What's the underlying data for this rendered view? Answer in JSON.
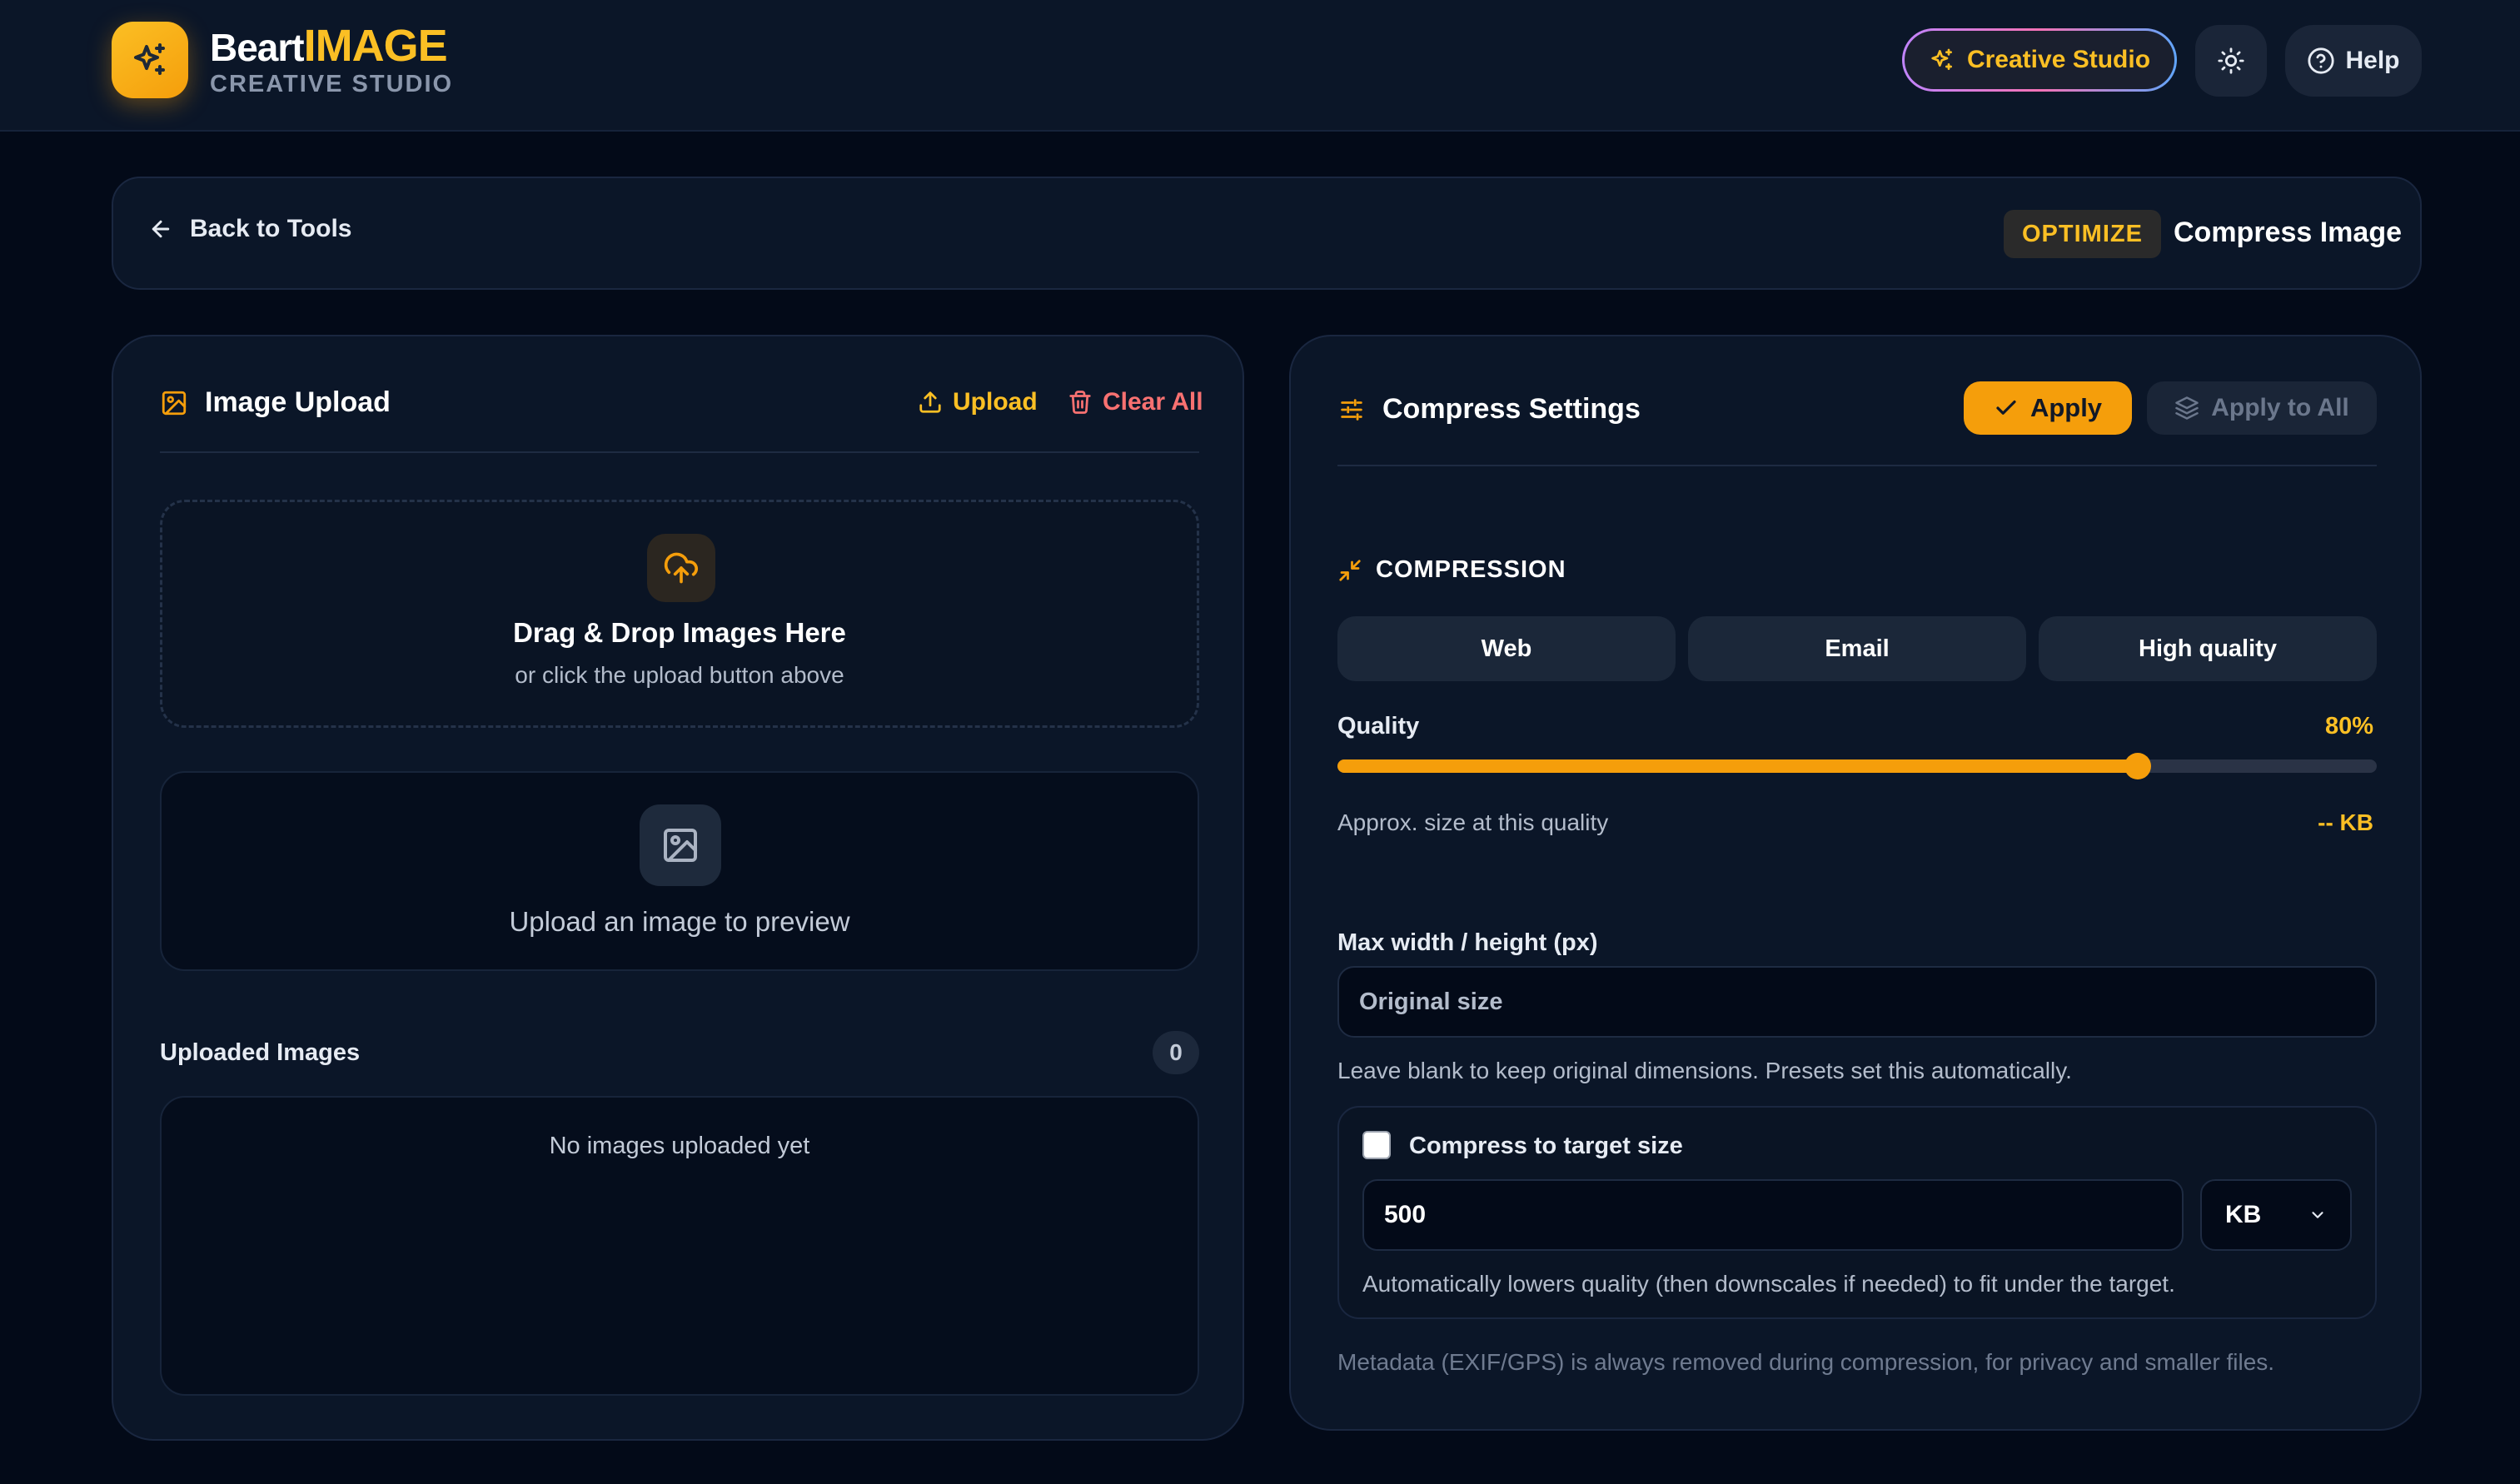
{
  "header": {
    "brand_part1": "Beart",
    "brand_part2": "IMAGE",
    "brand_sub": "CREATIVE STUDIO",
    "studio_label": "Creative Studio",
    "help_label": "Help",
    "accent": "#f59e0b"
  },
  "nav": {
    "back_label": "Back to Tools",
    "category_badge": "OPTIMIZE",
    "tool_title": "Compress Image"
  },
  "upload_panel": {
    "title": "Image Upload",
    "upload_label": "Upload",
    "clear_label": "Clear All",
    "dropzone_title": "Drag & Drop Images Here",
    "dropzone_sub": "or click the upload button above",
    "preview_text": "Upload an image to preview",
    "uploaded_label": "Uploaded Images",
    "uploaded_count": "0",
    "empty_message": "No images uploaded yet"
  },
  "settings_panel": {
    "title": "Compress Settings",
    "apply_label": "Apply",
    "apply_all_label": "Apply to All",
    "section_title": "COMPRESSION",
    "presets": [
      "Web",
      "Email",
      "High quality"
    ],
    "quality_label": "Quality",
    "quality_display": "80%",
    "quality_percent": 77,
    "approx_label": "Approx. size at this quality",
    "approx_value": "-- KB",
    "max_dim_label": "Max width / height (px)",
    "max_dim_placeholder": "Original size",
    "max_dim_help": "Leave blank to keep original dimensions. Presets set this automatically.",
    "target_label": "Compress to target size",
    "target_value": "500",
    "target_unit": "KB",
    "target_help": "Automatically lowers quality (then downscales if needed) to fit under the target.",
    "metadata_note": "Metadata (EXIF/GPS) is always removed during compression, for privacy and smaller files."
  }
}
